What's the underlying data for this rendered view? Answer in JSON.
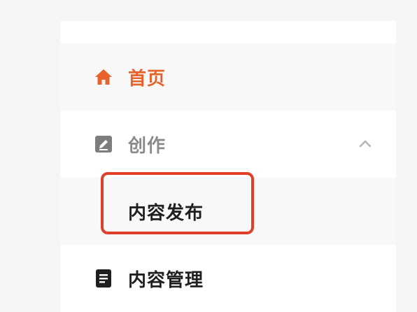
{
  "sidebar": {
    "items": [
      {
        "label": "首页",
        "icon": "home-icon",
        "state": "active"
      },
      {
        "label": "创作",
        "icon": "edit-icon",
        "state": "expanded",
        "chevron": "chevron-up-icon"
      },
      {
        "label": "内容发布",
        "state": "sub-item"
      },
      {
        "label": "内容管理",
        "icon": "document-icon"
      }
    ]
  },
  "colors": {
    "accent": "#e8632c",
    "highlight_border": "#e0402a",
    "muted_text": "#8a8a8a",
    "primary_text": "#1f1f1f"
  }
}
